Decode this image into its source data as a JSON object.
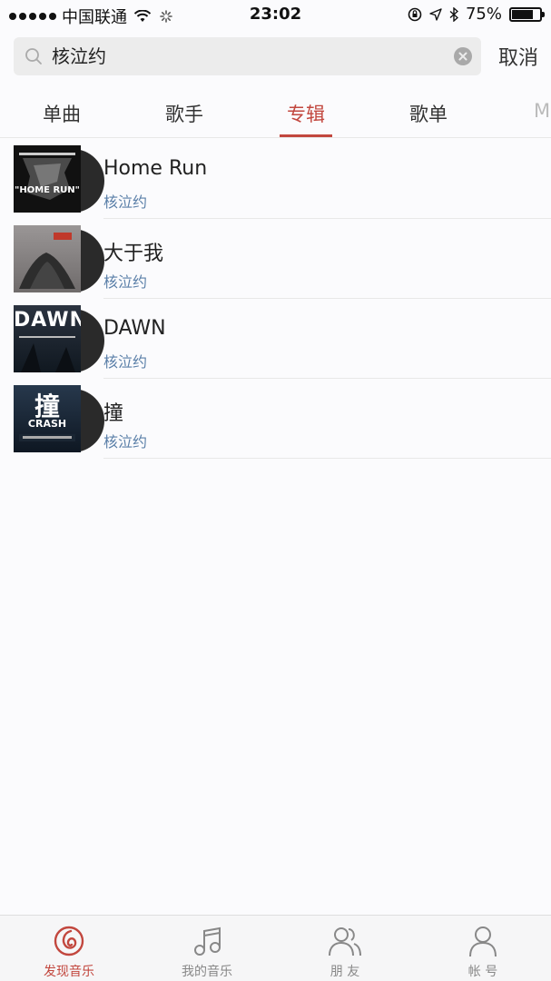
{
  "status_bar": {
    "carrier": "中国联通",
    "time": "23:02",
    "battery": "75%",
    "battery_level": 0.75
  },
  "search": {
    "query": "核泣约",
    "cancel_label": "取消"
  },
  "tabs": [
    {
      "label": "单曲",
      "active": false
    },
    {
      "label": "歌手",
      "active": false
    },
    {
      "label": "专辑",
      "active": true
    },
    {
      "label": "歌单",
      "active": false
    }
  ],
  "tab_overflow": "M",
  "albums": [
    {
      "title": "Home Run",
      "artist": "核泣约",
      "cover_text": "\"HOME RUN\""
    },
    {
      "title": "大于我",
      "artist": "核泣约",
      "cover_text": ""
    },
    {
      "title": "DAWN",
      "artist": "核泣约",
      "cover_text": "DAWN"
    },
    {
      "title": "撞",
      "artist": "核泣约",
      "cover_text": "撞",
      "cover_subtext": "CRASH"
    }
  ],
  "tabbar": [
    {
      "label": "发现音乐",
      "icon": "netease-logo-icon",
      "active": true
    },
    {
      "label": "我的音乐",
      "icon": "music-note-icon",
      "active": false
    },
    {
      "label": "朋 友",
      "icon": "friends-icon",
      "active": false
    },
    {
      "label": "帐 号",
      "icon": "account-icon",
      "active": false
    }
  ],
  "colors": {
    "accent": "#c2473e",
    "artist_link": "#5a7fa8"
  }
}
